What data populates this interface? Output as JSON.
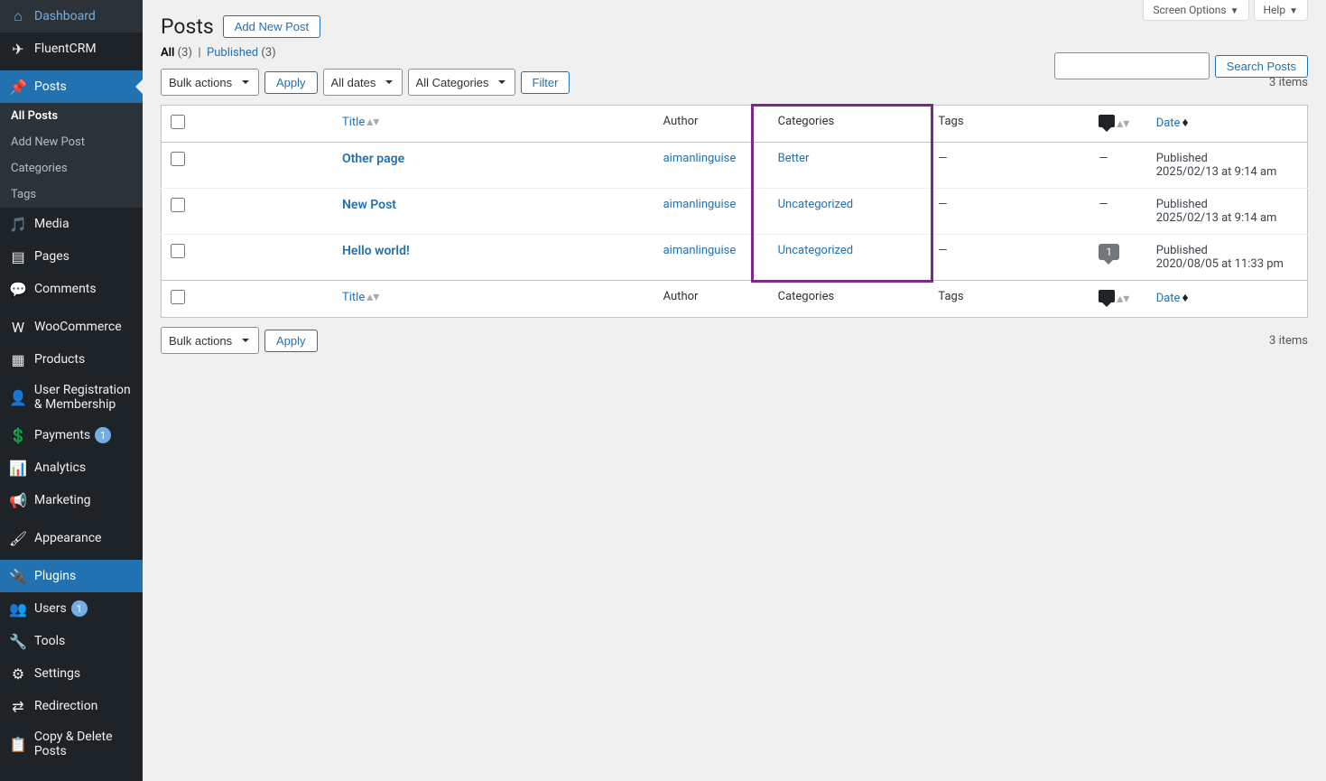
{
  "topTabs": {
    "screenOptions": "Screen Options",
    "help": "Help"
  },
  "sidebar": {
    "items": [
      {
        "label": "Dashboard",
        "icon": "dashboard"
      },
      {
        "label": "FluentCRM",
        "icon": "fluentcrm"
      },
      {
        "label": "Posts",
        "icon": "pin",
        "current": true
      },
      {
        "label": "Media",
        "icon": "media"
      },
      {
        "label": "Pages",
        "icon": "pages"
      },
      {
        "label": "Comments",
        "icon": "comments"
      },
      {
        "label": "WooCommerce",
        "icon": "woo"
      },
      {
        "label": "Products",
        "icon": "products"
      },
      {
        "label": "User Registration & Membership",
        "icon": "userreg"
      },
      {
        "label": "Payments",
        "icon": "payments",
        "badge": "1",
        "badgeClass": "blue"
      },
      {
        "label": "Analytics",
        "icon": "analytics"
      },
      {
        "label": "Marketing",
        "icon": "marketing"
      },
      {
        "label": "Appearance",
        "icon": "appearance"
      },
      {
        "label": "Plugins",
        "icon": "plugins",
        "highlighted": true
      },
      {
        "label": "Users",
        "icon": "users",
        "badge": "1",
        "badgeClass": "blue"
      },
      {
        "label": "Tools",
        "icon": "tools"
      },
      {
        "label": "Settings",
        "icon": "settings"
      },
      {
        "label": "Redirection",
        "icon": "redirection"
      },
      {
        "label": "Copy & Delete Posts",
        "icon": "copyposts"
      }
    ],
    "submenu": [
      {
        "label": "All Posts",
        "current": true
      },
      {
        "label": "Add New Post"
      },
      {
        "label": "Categories"
      },
      {
        "label": "Tags"
      }
    ]
  },
  "page": {
    "title": "Posts",
    "addNew": "Add New Post",
    "filters": {
      "allLabel": "All",
      "allCount": "(3)",
      "publishedLabel": "Published",
      "publishedCount": "(3)"
    },
    "searchButton": "Search Posts",
    "bulkActions": "Bulk actions",
    "apply": "Apply",
    "allDates": "All dates",
    "allCategories": "All Categories",
    "filter": "Filter",
    "itemCount": "3 items"
  },
  "columns": {
    "title": "Title",
    "author": "Author",
    "categories": "Categories",
    "tags": "Tags",
    "date": "Date"
  },
  "rows": [
    {
      "title": "Other page",
      "author": "aimanlinguise",
      "categories": "Better",
      "tags": "—",
      "comments": "—",
      "dateStatus": "Published",
      "dateValue": "2025/02/13 at 9:14 am"
    },
    {
      "title": "New Post",
      "author": "aimanlinguise",
      "categories": "Uncategorized",
      "tags": "—",
      "comments": "—",
      "dateStatus": "Published",
      "dateValue": "2025/02/13 at 9:14 am"
    },
    {
      "title": "Hello world!",
      "author": "aimanlinguise",
      "categories": "Uncategorized",
      "tags": "—",
      "comments": "1",
      "dateStatus": "Published",
      "dateValue": "2020/08/05 at 11:33 pm"
    }
  ]
}
